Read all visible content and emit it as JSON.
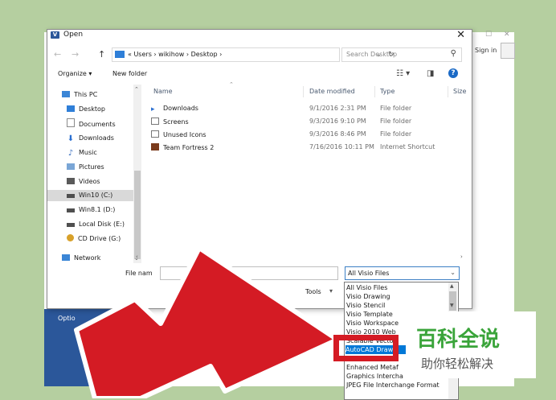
{
  "background": {
    "options_label": "Optio",
    "signin_label": "Sign in",
    "min_symbol": "—",
    "max_symbol": "☐",
    "close_symbol": "✕"
  },
  "dialog": {
    "title": "Open",
    "title_icon_letter": "V",
    "close_symbol": "✕"
  },
  "address": {
    "back_symbol": "←",
    "forward_symbol": "→",
    "up_symbol": "↑",
    "path_prefix": "«",
    "segments": [
      "Users",
      "wikihow",
      "Desktop"
    ],
    "separator": "›",
    "refresh_symbol": "↻",
    "search_placeholder": "Search Desktop",
    "search_icon": "search-icon"
  },
  "toolbar": {
    "organize": "Organize ▾",
    "new_folder": "New folder",
    "view_icon": "view-options-icon",
    "preview_icon": "preview-pane-icon",
    "help_label": "?"
  },
  "nav_pane": {
    "items": [
      {
        "label": "This PC",
        "icon": "computer-icon",
        "color": "#3b86d6"
      },
      {
        "label": "Desktop",
        "icon": "desktop-icon",
        "color": "#2f7fd8"
      },
      {
        "label": "Documents",
        "icon": "documents-icon",
        "color": "#8a8a8a"
      },
      {
        "label": "Downloads",
        "icon": "downloads-icon",
        "color": "#2a6fd1"
      },
      {
        "label": "Music",
        "icon": "music-icon",
        "color": "#3a6fc0"
      },
      {
        "label": "Pictures",
        "icon": "pictures-icon",
        "color": "#7aa6d6"
      },
      {
        "label": "Videos",
        "icon": "videos-icon",
        "color": "#5a5a5a"
      },
      {
        "label": "Win10 (C:)",
        "icon": "drive-c-icon",
        "color": "#4f4f4f"
      },
      {
        "label": "Win8.1 (D:)",
        "icon": "drive-d-icon",
        "color": "#4f4f4f"
      },
      {
        "label": "Local Disk (E:)",
        "icon": "drive-e-icon",
        "color": "#4f4f4f"
      },
      {
        "label": "CD Drive (G:)",
        "icon": "cd-drive-icon",
        "color": "#d8a12a"
      },
      {
        "label": "Network",
        "icon": "network-icon",
        "color": "#3b86d6"
      }
    ]
  },
  "file_list": {
    "columns": [
      "Name",
      "Date modified",
      "Type",
      "Size"
    ],
    "rows": [
      {
        "name": "Downloads",
        "date": "9/1/2016 2:31 PM",
        "type": "File folder",
        "icon": "folder-downloads-icon"
      },
      {
        "name": "Screens",
        "date": "9/3/2016 9:10 PM",
        "type": "File folder",
        "icon": "folder-icon"
      },
      {
        "name": "Unused Icons",
        "date": "9/3/2016 8:46 PM",
        "type": "File folder",
        "icon": "folder-icon"
      },
      {
        "name": "Team Fortress 2",
        "date": "7/16/2016 10:11 PM",
        "type": "Internet Shortcut",
        "icon": "shortcut-icon"
      }
    ]
  },
  "bottom": {
    "file_name_label": "File nam",
    "file_name_value": "",
    "file_type_selected": "All Visio Files",
    "tools_label": "Tools",
    "drop_symbol": "⌄"
  },
  "file_type_options": [
    "All Visio Files",
    "Visio Drawing",
    "Visio Stencil",
    "Visio Template",
    "Visio Workspace",
    "Visio 2010 Web",
    "Scalable Vector",
    "AutoCAD Drawi",
    "",
    "Enhanced Metaf",
    "Graphics Intercha",
    "JPEG File Interchange Format"
  ],
  "highlighted_option_index": 7,
  "watermark": {
    "title": "百科全说",
    "subtitle": "助你轻松解决"
  },
  "colors": {
    "accent_red": "#d41b24",
    "selection_blue": "#0078d7",
    "logo_green": "#3aa43a",
    "page_bg": "#b5cfa0"
  }
}
